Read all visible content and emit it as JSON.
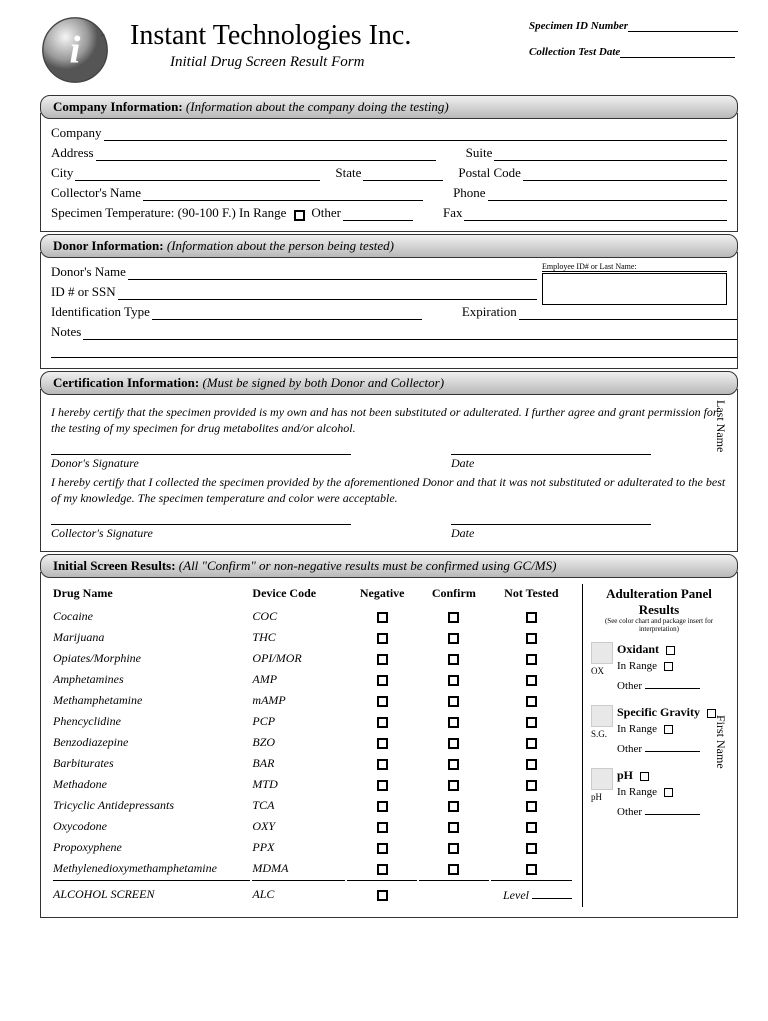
{
  "header": {
    "company": "Instant Technologies Inc.",
    "subtitle": "Initial Drug Screen Result Form",
    "specimen_id_label": "Specimen ID Number",
    "collection_date_label": "Collection Test Date"
  },
  "sections": {
    "company": {
      "title": "Company Information:",
      "hint": "(Information about the company doing the testing)",
      "fields": {
        "company": "Company",
        "address": "Address",
        "suite": "Suite",
        "city": "City",
        "state": "State",
        "postal": "Postal Code",
        "collector": "Collector's Name",
        "phone": "Phone",
        "spec_temp": "Specimen Temperature: (90-100 F.) In Range",
        "other": "Other",
        "fax": "Fax"
      }
    },
    "donor": {
      "title": "Donor Information:",
      "hint": "(Information about the person being tested)",
      "fields": {
        "name": "Donor's Name",
        "id_ssn": "ID # or SSN",
        "id_type": "Identification Type",
        "expiration": "Expiration",
        "notes": "Notes",
        "employee_box": "Employee ID# or Last Name:"
      }
    },
    "cert": {
      "title": "Certification Information:",
      "hint": "(Must be signed by both Donor and Collector)",
      "donor_text": "I hereby certify that the specimen provided is my own and has not been substituted or adulterated. I further agree and grant permission for the testing of my specimen for drug metabolites and/or alcohol.",
      "donor_sig": "Donor's Signature",
      "date": "Date",
      "collector_text": "I hereby certify that I collected the specimen provided by the aforementioned Donor and that it was not substituted or adulterated to the best of my knowledge. The specimen temperature and color were acceptable.",
      "collector_sig": "Collector's Signature"
    },
    "results": {
      "title": "Initial Screen Results:",
      "hint": "(All \"Confirm\" or non-negative results must be confirmed using GC/MS)",
      "columns": {
        "drug": "Drug Name",
        "code": "Device Code",
        "neg": "Negative",
        "conf": "Confirm",
        "nt": "Not Tested"
      },
      "drugs": [
        {
          "name": "Cocaine",
          "code": "COC"
        },
        {
          "name": "Marijuana",
          "code": "THC"
        },
        {
          "name": "Opiates/Morphine",
          "code": "OPI/MOR"
        },
        {
          "name": "Amphetamines",
          "code": "AMP"
        },
        {
          "name": "Methamphetamine",
          "code": "mAMP"
        },
        {
          "name": "Phencyclidine",
          "code": "PCP"
        },
        {
          "name": "Benzodiazepine",
          "code": "BZO"
        },
        {
          "name": "Barbiturates",
          "code": "BAR"
        },
        {
          "name": "Methadone",
          "code": "MTD"
        },
        {
          "name": "Tricyclic Antidepressants",
          "code": "TCA"
        },
        {
          "name": "Oxycodone",
          "code": "OXY"
        },
        {
          "name": "Propoxyphene",
          "code": "PPX"
        },
        {
          "name": "Methylenedioxymethamphetamine",
          "code": "MDMA"
        }
      ],
      "alcohol": {
        "name": "ALCOHOL SCREEN",
        "code": "ALC",
        "level": "Level"
      },
      "adulteration": {
        "title": "Adulteration Panel Results",
        "sub": "(See color chart and package insert for interpretation)",
        "panels": [
          {
            "name": "Oxidant",
            "abbr": "OX",
            "in_range": "In Range",
            "other": "Other"
          },
          {
            "name": "Specific Gravity",
            "abbr": "S.G.",
            "in_range": "In Range",
            "other": "Other"
          },
          {
            "name": "pH",
            "abbr": "pH",
            "in_range": "In Range",
            "other": "Other"
          }
        ]
      }
    }
  },
  "side_labels": {
    "last_name": "Last Name",
    "first_name": "First Name"
  }
}
